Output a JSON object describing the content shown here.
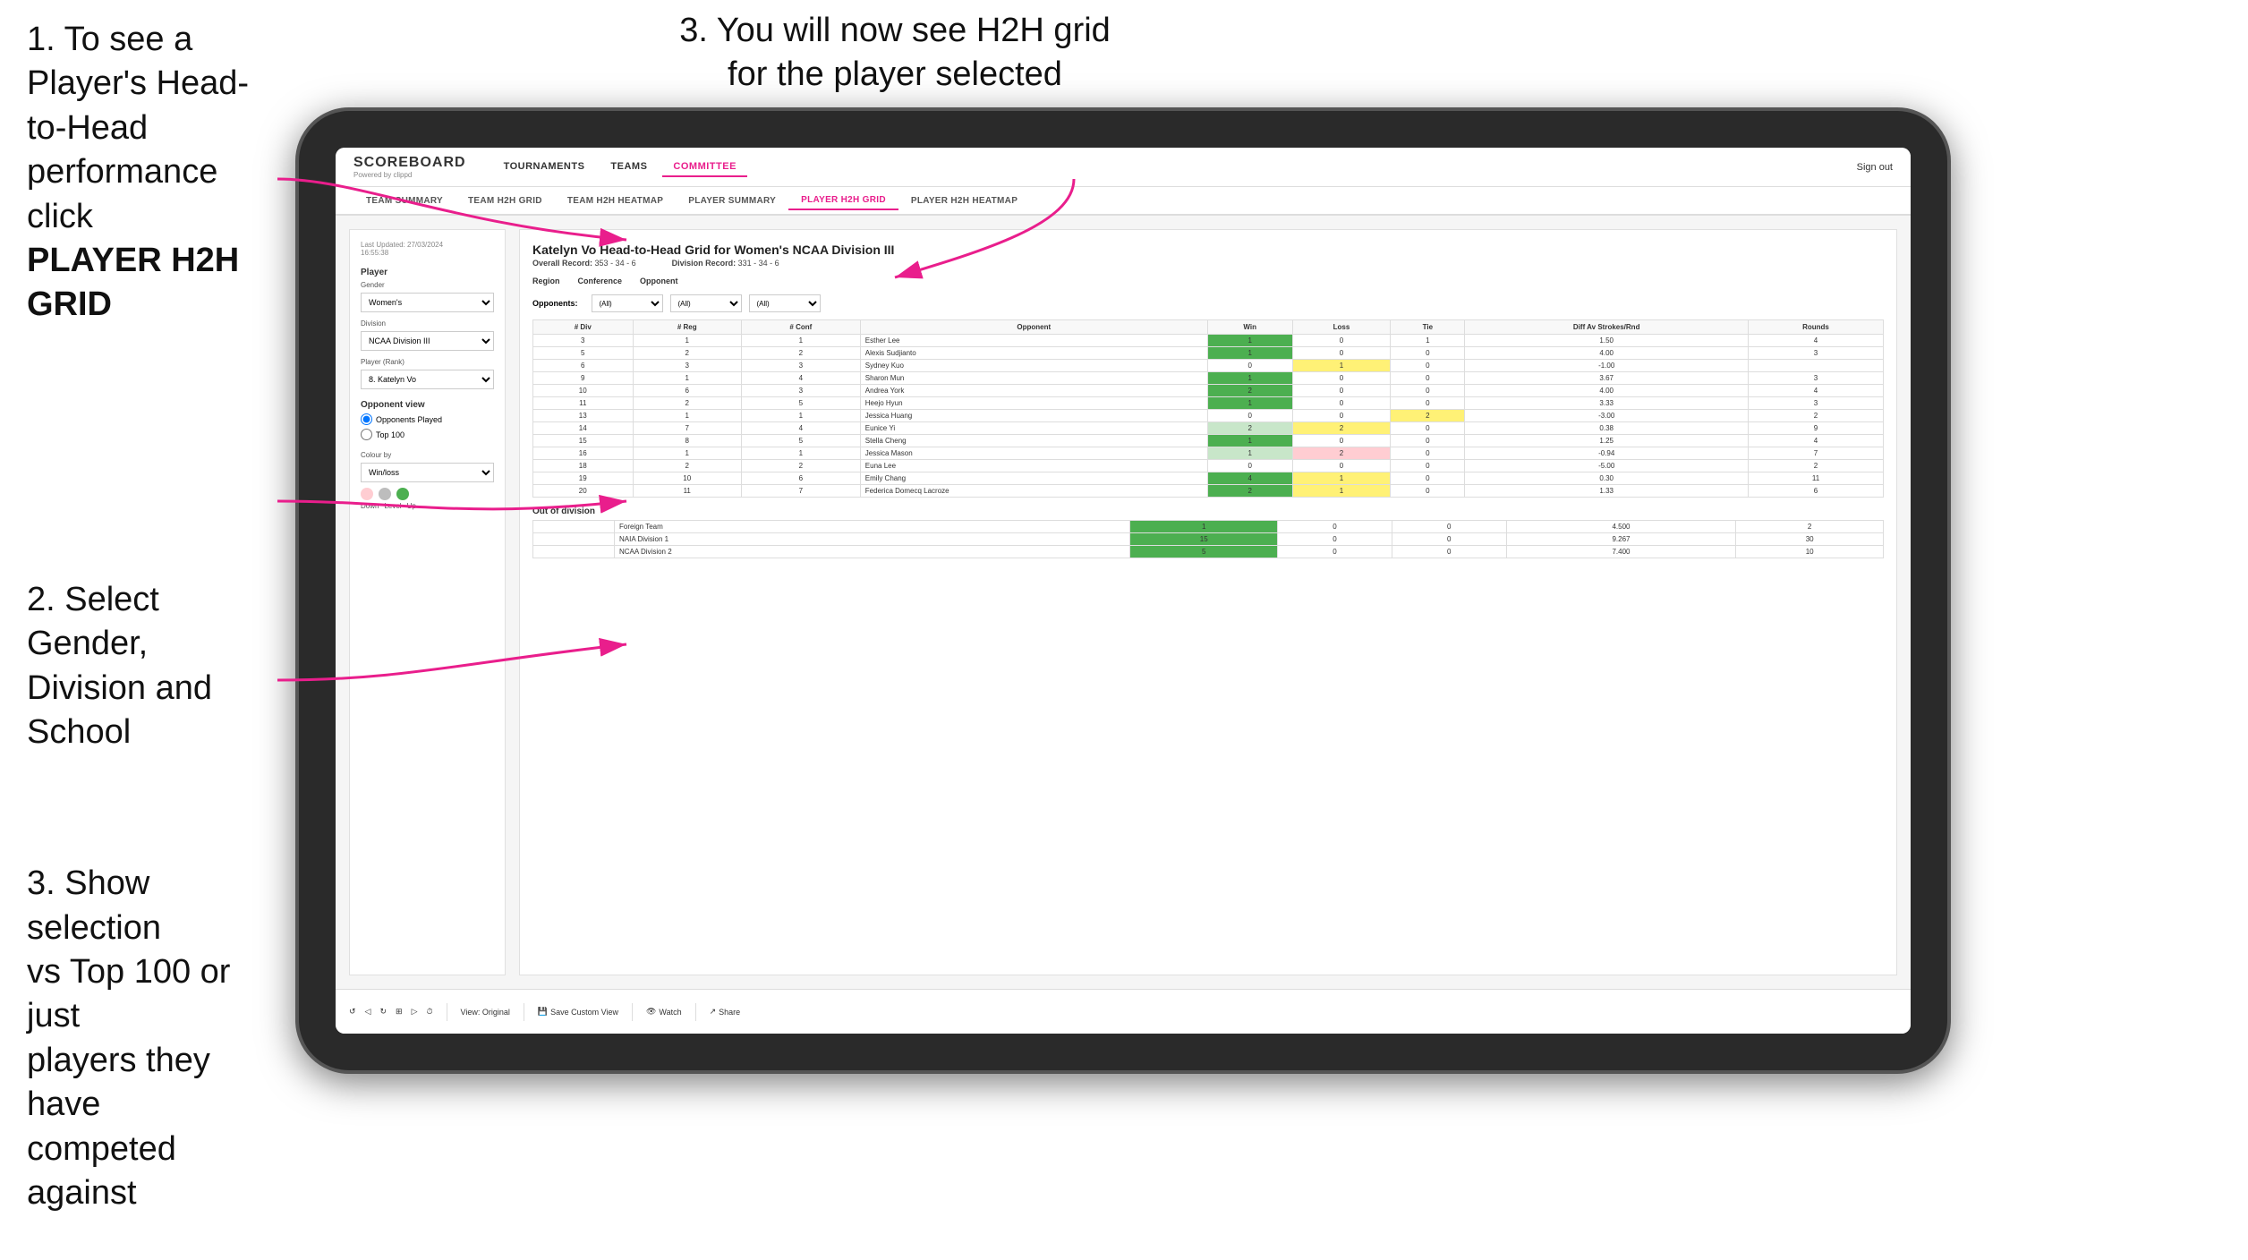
{
  "instructions": {
    "step1_text": "1. To see a Player's Head-to-Head performance click",
    "step1_bold": "PLAYER H2H GRID",
    "step2_text": "2. Select Gender,\nDivision and\nSchool",
    "step3_left_text": "3. Show selection\nvs Top 100 or just\nplayers they have\ncompeted against",
    "step3_right_text": "3. You will now see H2H grid\nfor the player selected"
  },
  "header": {
    "logo": "SCOREBOARD",
    "logo_sub": "Powered by clippd",
    "nav_items": [
      "TOURNAMENTS",
      "TEAMS",
      "COMMITTEE"
    ],
    "active_nav": "COMMITTEE",
    "sign_out": "Sign out"
  },
  "sub_nav": {
    "items": [
      "TEAM SUMMARY",
      "TEAM H2H GRID",
      "TEAM H2H HEATMAP",
      "PLAYER SUMMARY",
      "PLAYER H2H GRID",
      "PLAYER H2H HEATMAP"
    ],
    "active": "PLAYER H2H GRID"
  },
  "left_panel": {
    "last_updated_label": "Last Updated: 27/03/2024",
    "last_updated_time": "16:55:38",
    "player_label": "Player",
    "gender_label": "Gender",
    "gender_value": "Women's",
    "division_label": "Division",
    "division_value": "NCAA Division III",
    "player_rank_label": "Player (Rank)",
    "player_rank_value": "8. Katelyn Vo",
    "opponent_view_label": "Opponent view",
    "radio1": "Opponents Played",
    "radio2": "Top 100",
    "colour_label": "Colour by",
    "colour_value": "Win/loss",
    "legend_down": "Down",
    "legend_level": "Level",
    "legend_up": "Up"
  },
  "grid": {
    "title": "Katelyn Vo Head-to-Head Grid for Women's NCAA Division III",
    "overall_record_label": "Overall Record:",
    "overall_record_value": "353 - 34 - 6",
    "division_record_label": "Division Record:",
    "division_record_value": "331 - 34 - 6",
    "region_filter_label": "Region",
    "conference_filter_label": "Conference",
    "opponent_filter_label": "Opponent",
    "opponents_label": "Opponents:",
    "opponents_value": "(All)",
    "conference_value": "(All)",
    "opponent_value": "(All)",
    "col_headers": [
      "# Div",
      "# Reg",
      "# Conf",
      "Opponent",
      "Win",
      "Loss",
      "Tie",
      "Diff Av Strokes/Rnd",
      "Rounds"
    ],
    "rows": [
      {
        "div": "3",
        "reg": "1",
        "conf": "1",
        "opponent": "Esther Lee",
        "win": "1",
        "loss": "0",
        "tie": "1",
        "diff": "1.50",
        "rounds": "4",
        "win_color": "green_dark",
        "loss_color": "white",
        "tie_color": "white"
      },
      {
        "div": "5",
        "reg": "2",
        "conf": "2",
        "opponent": "Alexis Sudjianto",
        "win": "1",
        "loss": "0",
        "tie": "0",
        "diff": "4.00",
        "rounds": "3",
        "win_color": "green_dark",
        "loss_color": "white",
        "tie_color": "white"
      },
      {
        "div": "6",
        "reg": "3",
        "conf": "3",
        "opponent": "Sydney Kuo",
        "win": "0",
        "loss": "1",
        "tie": "0",
        "diff": "-1.00",
        "rounds": "",
        "win_color": "white",
        "loss_color": "yellow",
        "tie_color": "white"
      },
      {
        "div": "9",
        "reg": "1",
        "conf": "4",
        "opponent": "Sharon Mun",
        "win": "1",
        "loss": "0",
        "tie": "0",
        "diff": "3.67",
        "rounds": "3",
        "win_color": "green_dark",
        "loss_color": "white",
        "tie_color": "white"
      },
      {
        "div": "10",
        "reg": "6",
        "conf": "3",
        "opponent": "Andrea York",
        "win": "2",
        "loss": "0",
        "tie": "0",
        "diff": "4.00",
        "rounds": "4",
        "win_color": "green_dark",
        "loss_color": "white",
        "tie_color": "white"
      },
      {
        "div": "11",
        "reg": "2",
        "conf": "5",
        "opponent": "Heejo Hyun",
        "win": "1",
        "loss": "0",
        "tie": "0",
        "diff": "3.33",
        "rounds": "3",
        "win_color": "green_dark",
        "loss_color": "white",
        "tie_color": "white"
      },
      {
        "div": "13",
        "reg": "1",
        "conf": "1",
        "opponent": "Jessica Huang",
        "win": "0",
        "loss": "0",
        "tie": "2",
        "diff": "-3.00",
        "rounds": "2",
        "win_color": "white",
        "loss_color": "white",
        "tie_color": "yellow"
      },
      {
        "div": "14",
        "reg": "7",
        "conf": "4",
        "opponent": "Eunice Yi",
        "win": "2",
        "loss": "2",
        "tie": "0",
        "diff": "0.38",
        "rounds": "9",
        "win_color": "green_light",
        "loss_color": "yellow",
        "tie_color": "white"
      },
      {
        "div": "15",
        "reg": "8",
        "conf": "5",
        "opponent": "Stella Cheng",
        "win": "1",
        "loss": "0",
        "tie": "0",
        "diff": "1.25",
        "rounds": "4",
        "win_color": "green_dark",
        "loss_color": "white",
        "tie_color": "white"
      },
      {
        "div": "16",
        "reg": "1",
        "conf": "1",
        "opponent": "Jessica Mason",
        "win": "1",
        "loss": "2",
        "tie": "0",
        "diff": "-0.94",
        "rounds": "7",
        "win_color": "green_light",
        "loss_color": "red_light",
        "tie_color": "white"
      },
      {
        "div": "18",
        "reg": "2",
        "conf": "2",
        "opponent": "Euna Lee",
        "win": "0",
        "loss": "0",
        "tie": "0",
        "diff": "-5.00",
        "rounds": "2",
        "win_color": "white",
        "loss_color": "white",
        "tie_color": "white"
      },
      {
        "div": "19",
        "reg": "10",
        "conf": "6",
        "opponent": "Emily Chang",
        "win": "4",
        "loss": "1",
        "tie": "0",
        "diff": "0.30",
        "rounds": "11",
        "win_color": "green_dark",
        "loss_color": "yellow",
        "tie_color": "white"
      },
      {
        "div": "20",
        "reg": "11",
        "conf": "7",
        "opponent": "Federica Domecq Lacroze",
        "win": "2",
        "loss": "1",
        "tie": "0",
        "diff": "1.33",
        "rounds": "6",
        "win_color": "green_dark",
        "loss_color": "yellow",
        "tie_color": "white"
      }
    ],
    "out_of_division_label": "Out of division",
    "out_of_division_rows": [
      {
        "opponent": "Foreign Team",
        "win": "1",
        "loss": "0",
        "tie": "0",
        "diff": "4.500",
        "rounds": "2"
      },
      {
        "opponent": "NAIA Division 1",
        "win": "15",
        "loss": "0",
        "tie": "0",
        "diff": "9.267",
        "rounds": "30"
      },
      {
        "opponent": "NCAA Division 2",
        "win": "5",
        "loss": "0",
        "tie": "0",
        "diff": "7.400",
        "rounds": "10"
      }
    ]
  },
  "toolbar": {
    "undo": "↺",
    "redo": "↻",
    "view_label": "View: Original",
    "save_label": "Save Custom View",
    "watch_label": "Watch",
    "share_label": "Share"
  }
}
